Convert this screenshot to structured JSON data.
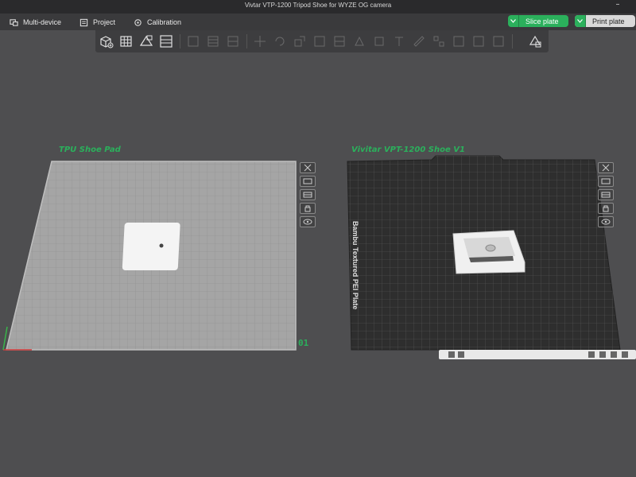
{
  "window": {
    "title": "Vivtar VTP-1200 Tripod Shoe for WYZE OG camera"
  },
  "menu": {
    "items": [
      {
        "label": "Multi-device",
        "icon": "multi-device-icon"
      },
      {
        "label": "Project",
        "icon": "project-icon"
      },
      {
        "label": "Calibration",
        "icon": "calibration-icon"
      }
    ],
    "slice_label": "Slice plate",
    "print_label": "Print plate"
  },
  "toolbar": {
    "tools": [
      "add-object-icon",
      "grid-arrange-icon",
      "orient-icon",
      "layers-icon",
      "split-icon",
      "cut-icon",
      "support-icon",
      "seam-icon",
      "measure-icon",
      "text-icon",
      "variable-layer-icon"
    ]
  },
  "plates": [
    {
      "title": "TPU Shoe Pad",
      "number": "01"
    },
    {
      "title": "Vivitar VPT-1200 Shoe V1",
      "bed_label": "Bambu Textured PEI Plate"
    }
  ],
  "colors": {
    "accent": "#2bb05c",
    "background": "#4e4e50",
    "titlebar": "#2a2a2c",
    "menubar": "#3a3a3c"
  }
}
